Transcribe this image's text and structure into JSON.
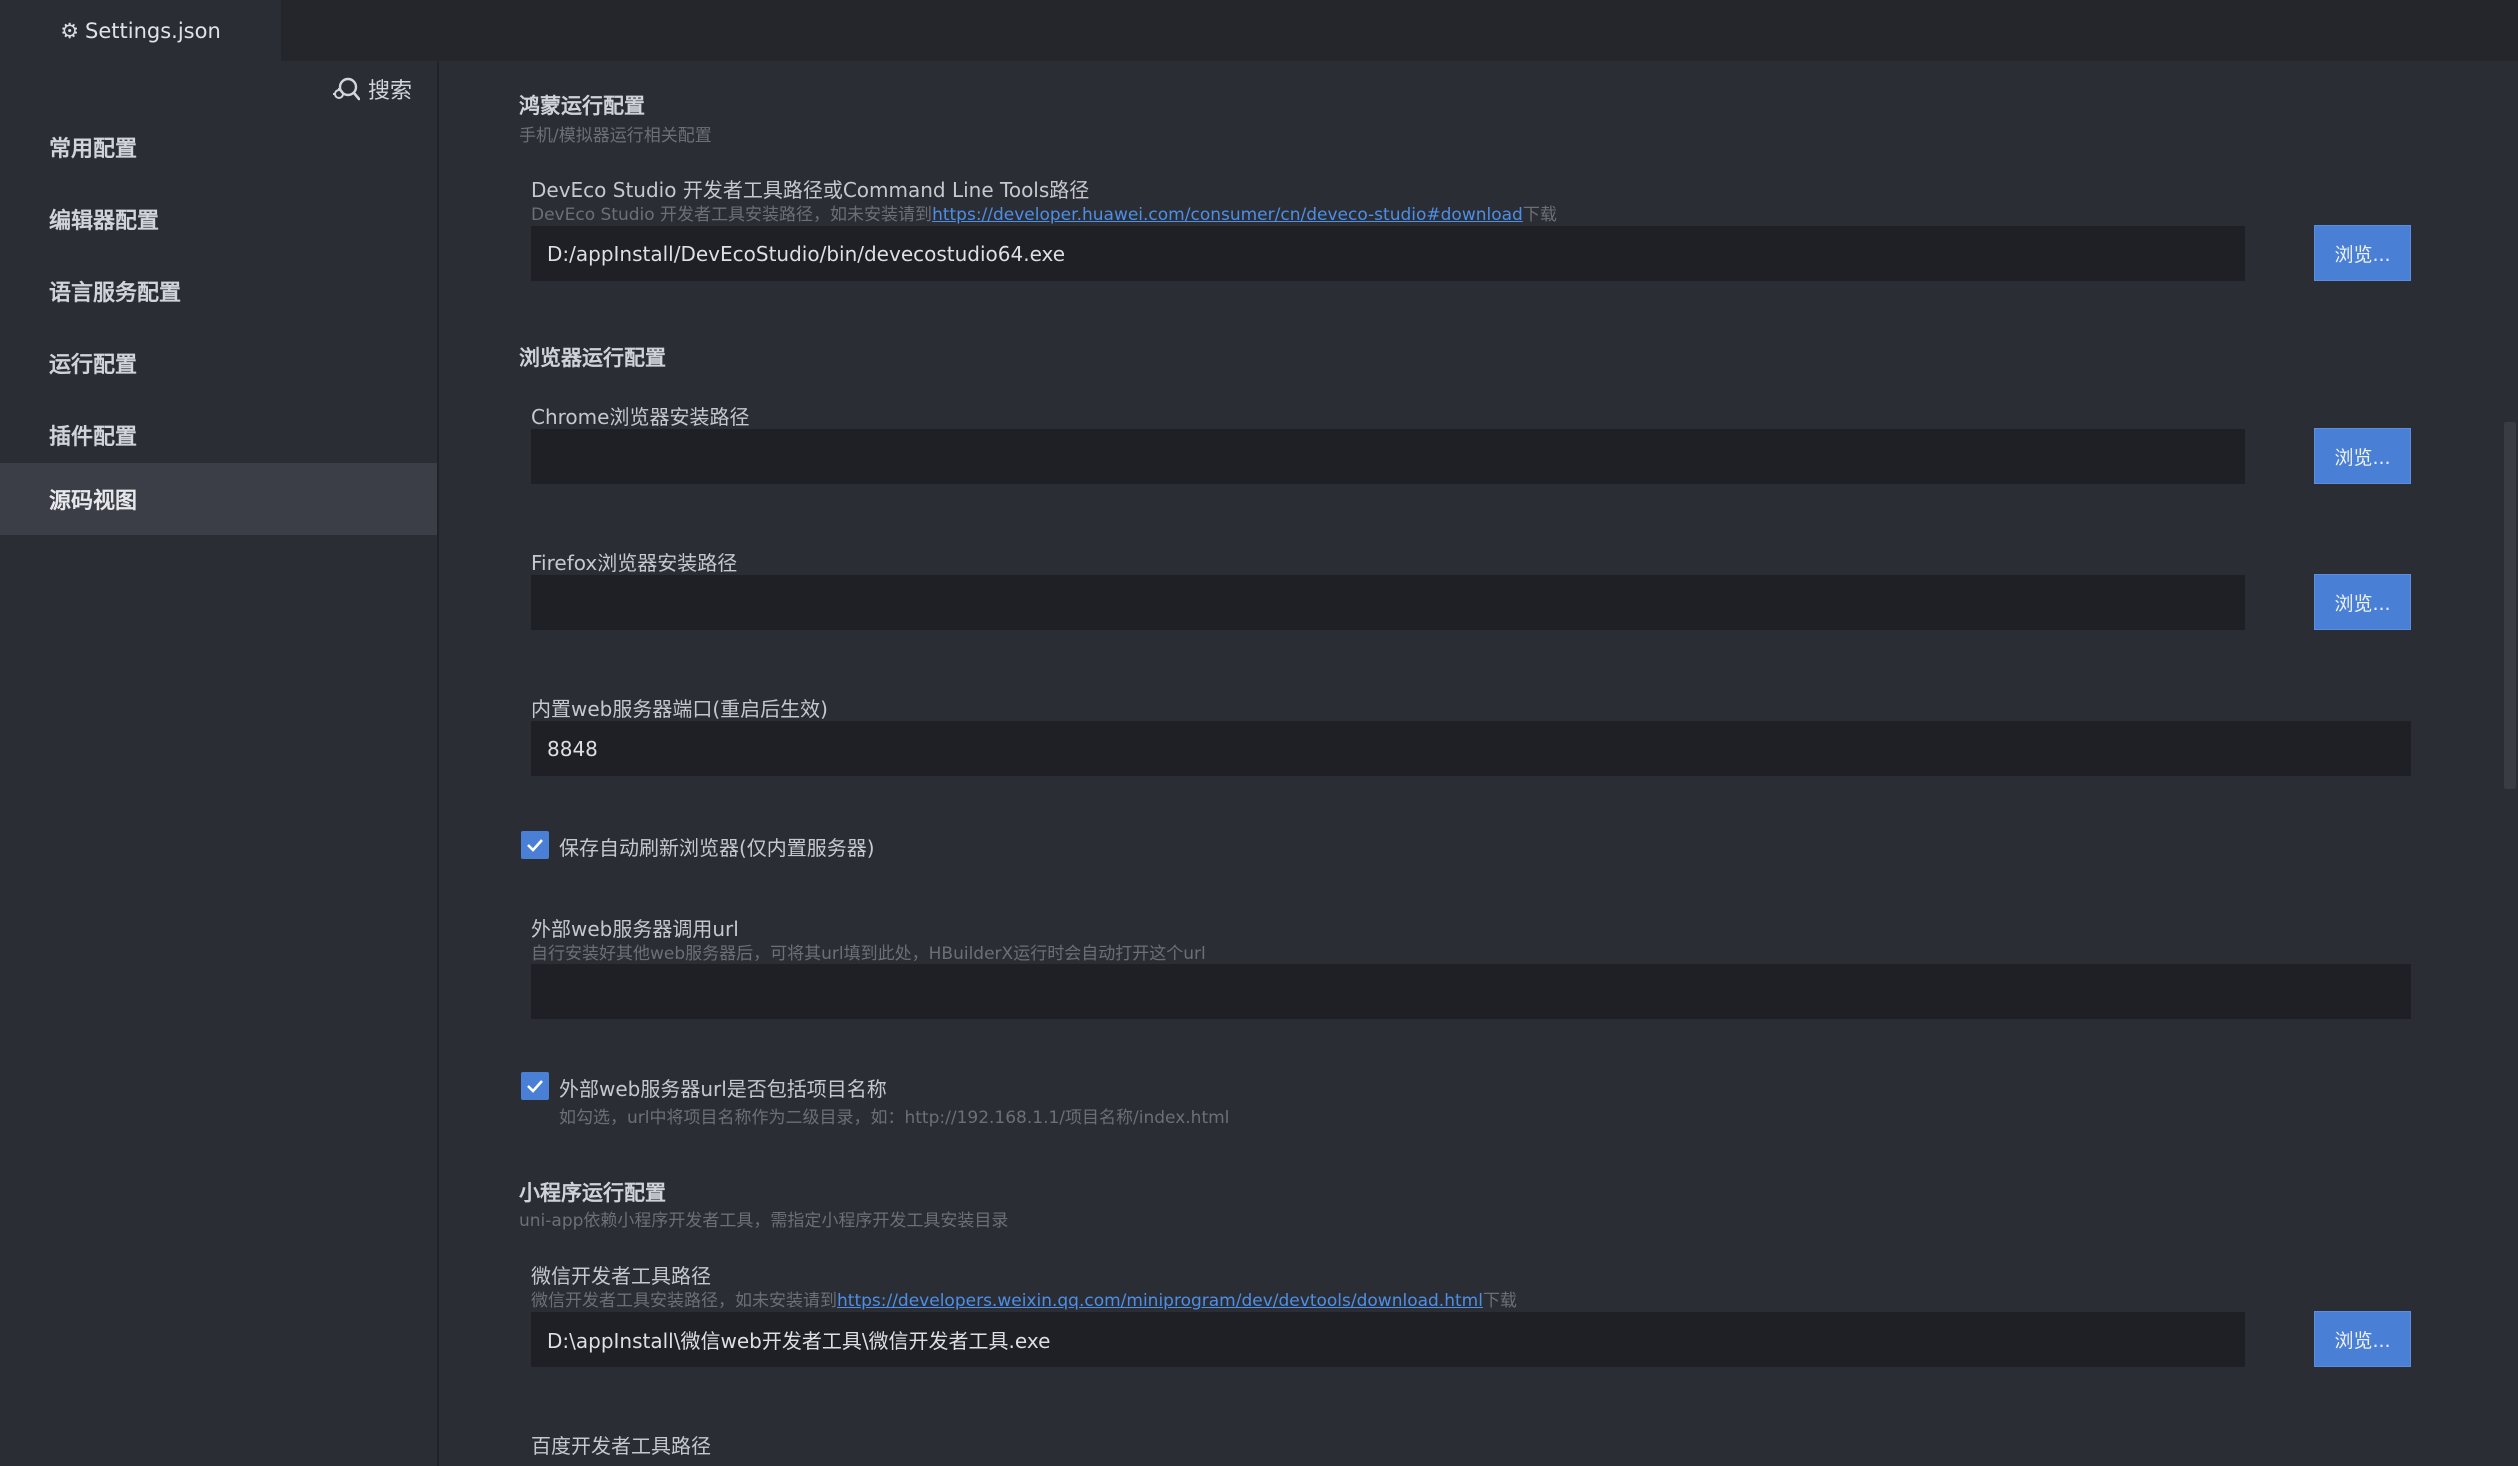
{
  "tab": {
    "title": "Settings.json",
    "icon": "gear-icon"
  },
  "search": {
    "label": "搜索",
    "icon": "search-settings-icon"
  },
  "sidebar": {
    "items": [
      {
        "label": "常用配置",
        "active": false
      },
      {
        "label": "编辑器配置",
        "active": false
      },
      {
        "label": "语言服务配置",
        "active": false
      },
      {
        "label": "运行配置",
        "active": false
      },
      {
        "label": "插件配置",
        "active": false
      },
      {
        "label": "源码视图",
        "active": true
      }
    ]
  },
  "sections": {
    "harmony": {
      "title": "鸿蒙运行配置",
      "subtitle": "手机/模拟器运行相关配置",
      "deveco": {
        "label": "DevEco Studio 开发者工具路径或Command Line Tools路径",
        "desc_prefix": "DevEco Studio 开发者工具安装路径，如未安装请到",
        "link": "https://developer.huawei.com/consumer/cn/deveco-studio#download",
        "desc_suffix": "下载",
        "value": "D:/appInstall/DevEcoStudio/bin/devecostudio64.exe",
        "button": "浏览..."
      }
    },
    "browser": {
      "title": "浏览器运行配置",
      "chrome": {
        "label": "Chrome浏览器安装路径",
        "value": "",
        "button": "浏览..."
      },
      "firefox": {
        "label": "Firefox浏览器安装路径",
        "value": "",
        "button": "浏览..."
      },
      "port": {
        "label": "内置web服务器端口(重启后生效)",
        "value": "8848"
      },
      "autorefresh": {
        "label": "保存自动刷新浏览器(仅内置服务器)",
        "checked": true
      },
      "external_url": {
        "label": "外部web服务器调用url",
        "desc": "自行安装好其他web服务器后，可将其url填到此处，HBuilderX运行时会自动打开这个url",
        "value": ""
      },
      "include_project": {
        "label": "外部web服务器url是否包括项目名称",
        "checked": true,
        "desc": "如勾选，url中将项目名称作为二级目录，如：http://192.168.1.1/项目名称/index.html"
      }
    },
    "miniprogram": {
      "title": "小程序运行配置",
      "subtitle": "uni-app依赖小程序开发者工具，需指定小程序开发工具安装目录",
      "wechat": {
        "label": "微信开发者工具路径",
        "desc_prefix": "微信开发者工具安装路径，如未安装请到",
        "link": "https://developers.weixin.qq.com/miniprogram/dev/devtools/download.html",
        "desc_suffix": "下载",
        "value": "D:\\appInstall\\微信web开发者工具\\微信开发者工具.exe",
        "button": "浏览..."
      },
      "baidu": {
        "label": "百度开发者工具路径"
      }
    }
  },
  "colors": {
    "accent": "#4a7fd6",
    "link": "#4d8fe6",
    "background": "#2b2d34",
    "input": "#1e2025"
  }
}
